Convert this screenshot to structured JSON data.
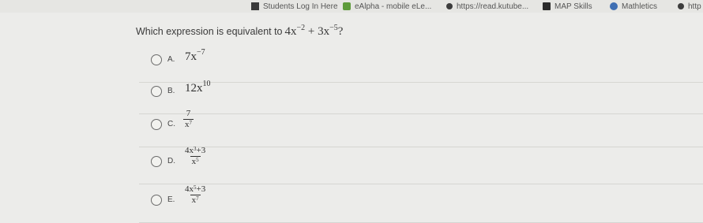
{
  "bookmarks": [
    {
      "label": "Students Log In Here",
      "icon": "bookmark-square-icon"
    },
    {
      "label": "eAlpha - mobile eLe...",
      "icon": "ealpha-favicon-icon"
    },
    {
      "label": "https://read.kutube...",
      "icon": "page-dot-icon"
    },
    {
      "label": "MAP Skills",
      "icon": "map-skills-icon"
    },
    {
      "label": "Mathletics",
      "icon": "mathletics-icon"
    },
    {
      "label": "http",
      "icon": "page-dot-icon"
    }
  ],
  "question": {
    "text": "Which expression is equivalent to",
    "expr_a": "4x",
    "exp_a": "−2",
    "expr_plus": " + 3x",
    "exp_b": "−5",
    "end": "?"
  },
  "options": [
    {
      "letter": "A.",
      "base": "7x",
      "exp": "−7"
    },
    {
      "letter": "B.",
      "base": "12x",
      "exp": "10"
    },
    {
      "letter": "C.",
      "num": "7",
      "den_base": "x",
      "den_exp": "7"
    },
    {
      "letter": "D.",
      "num_base": "4x",
      "num_exp": "3",
      "num_rest": "+3",
      "den_base": "x",
      "den_exp": "5"
    },
    {
      "letter": "E.",
      "num_base": "4x",
      "num_exp": "5",
      "num_rest": "+3",
      "den_base": "x",
      "den_exp": "7"
    }
  ]
}
